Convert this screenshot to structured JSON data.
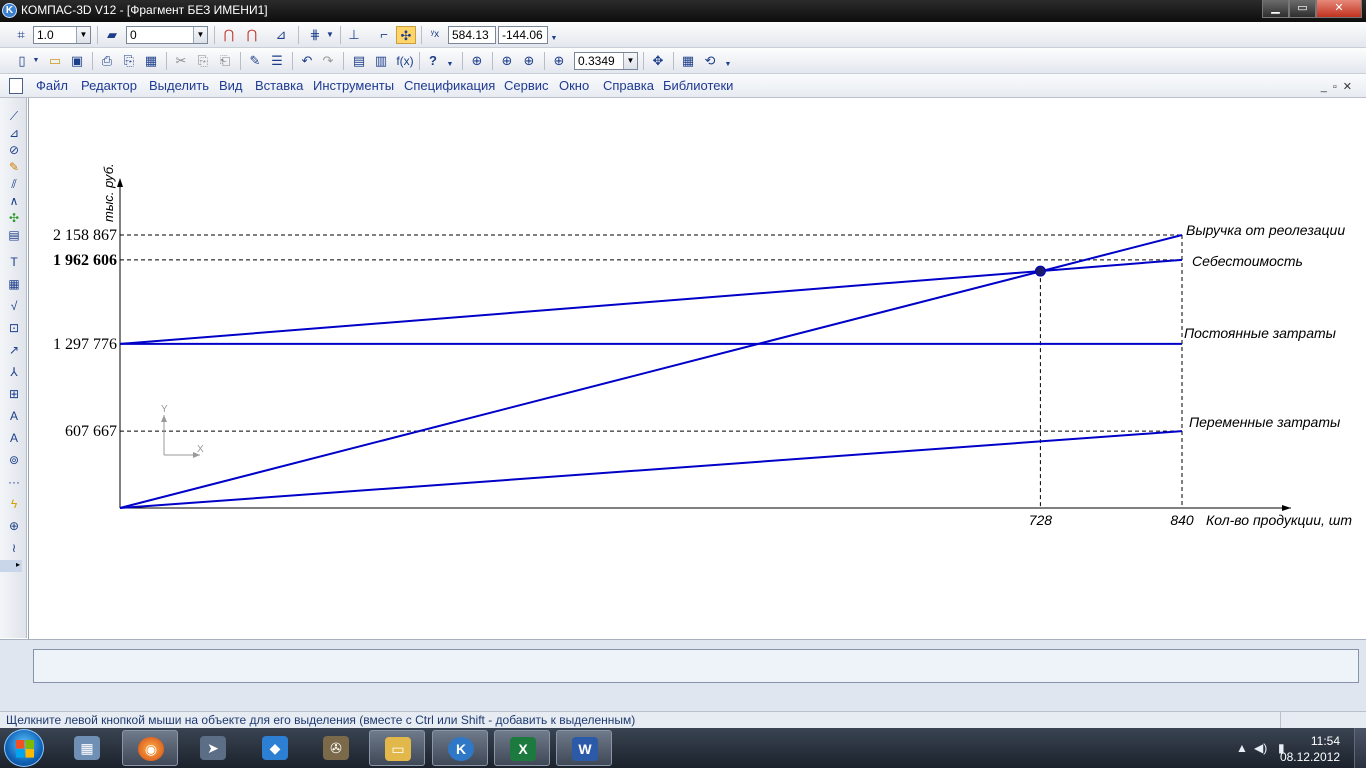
{
  "window": {
    "app_icon_letter": "K",
    "title": "КОМПАС-3D V12 - [Фрагмент БЕЗ ИМЕНИ1]",
    "minimize": "▁",
    "maximize": "▭",
    "close": "✕"
  },
  "toolbar1": {
    "scale_value": "1.0",
    "layer_value": "0",
    "coord_x": "584.13",
    "coord_y": "-144.06"
  },
  "toolbar2": {
    "zoom_value": "0.3349",
    "fx_label": "f(x)"
  },
  "menu": {
    "items": [
      "Файл",
      "Редактор",
      "Выделить",
      "Вид",
      "Вставка",
      "Инструменты",
      "Спецификация",
      "Сервис",
      "Окно",
      "Справка",
      "Библиотеки"
    ]
  },
  "chart_data": {
    "type": "line",
    "title": "",
    "ylabel": "тыс. руб.",
    "xlabel": "Кол-во продукции, шт",
    "xlim": [
      0,
      840
    ],
    "ylim": [
      0,
      2158867
    ],
    "y_ticks": [
      {
        "value": 2158867,
        "label": "2 158 867",
        "bold": false
      },
      {
        "value": 1962606,
        "label": "1 962 606",
        "bold": true
      },
      {
        "value": 1297776,
        "label": "1 297 776",
        "bold": false
      },
      {
        "value": 607667,
        "label": "607 667",
        "bold": false
      }
    ],
    "x_ticks": [
      {
        "value": 728,
        "label": "728"
      },
      {
        "value": 840,
        "label": "840"
      }
    ],
    "series": [
      {
        "name": "Выручка от реолезации",
        "x": [
          0,
          840
        ],
        "y": [
          0,
          2158867
        ]
      },
      {
        "name": "Себестоимость",
        "x": [
          0,
          840
        ],
        "y": [
          1297776,
          1962606
        ]
      },
      {
        "name": "Постоянные затраты",
        "x": [
          0,
          840
        ],
        "y": [
          1297776,
          1297776
        ]
      },
      {
        "name": "Переменные затраты",
        "x": [
          0,
          840
        ],
        "y": [
          0,
          607667
        ]
      }
    ],
    "break_even": {
      "x": 728,
      "y": 1873000
    },
    "line_color": "#0000c8",
    "coord_axes": {
      "x": "X",
      "y": "Y"
    }
  },
  "status": {
    "message": "Щелкните левой кнопкой мыши на объекте для его выделения (вместе с Ctrl или Shift - добавить к выделенным)"
  },
  "taskbar": {
    "time": "11:54",
    "date": "08.12.2012",
    "apps": [
      "calculator",
      "firefox",
      "app-arrow",
      "virtualbox",
      "media-player",
      "file-explorer",
      "kompas",
      "excel",
      "word"
    ]
  }
}
